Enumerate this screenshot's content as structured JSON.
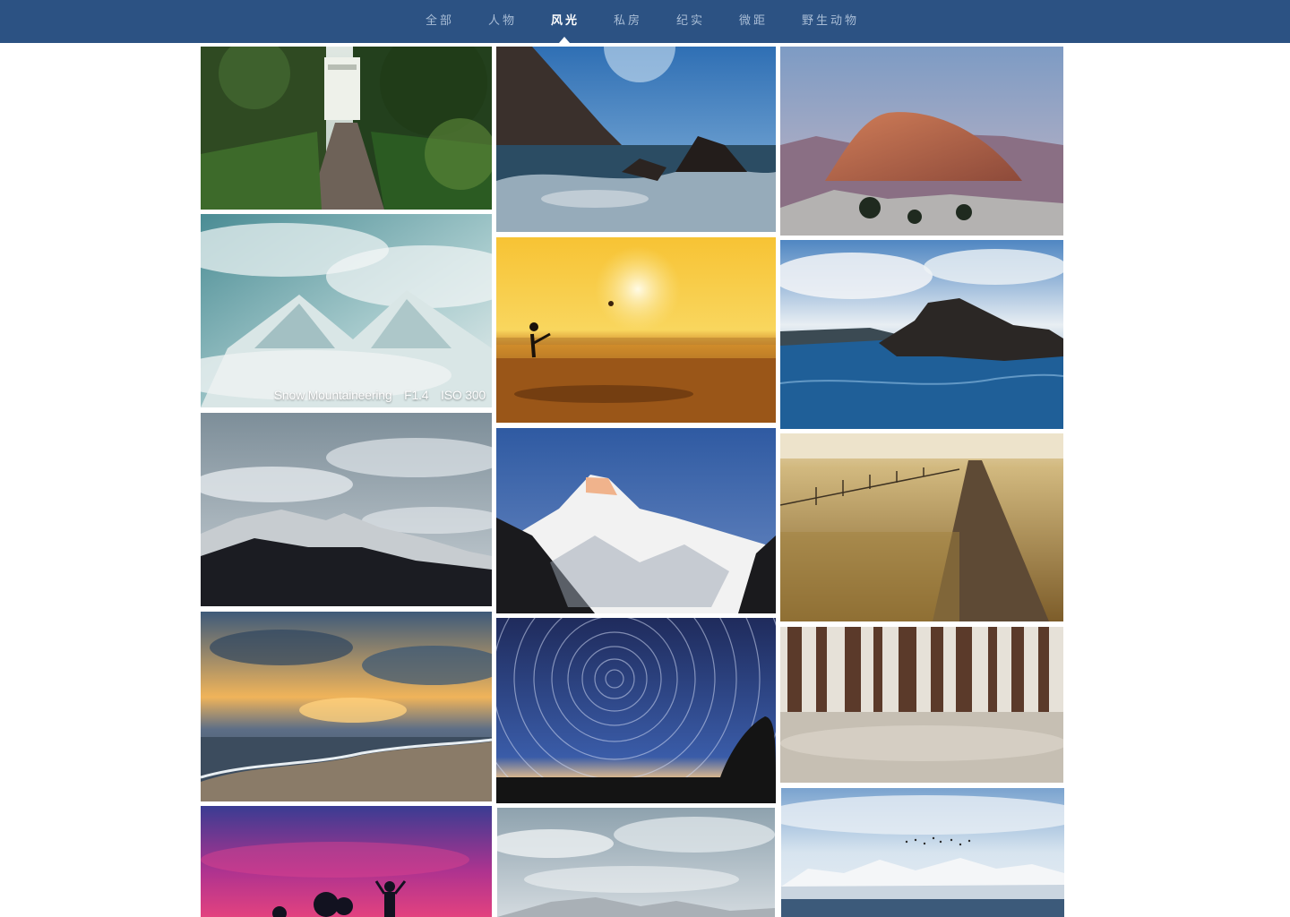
{
  "nav": {
    "items": [
      {
        "label": "全部",
        "active": false
      },
      {
        "label": "人物",
        "active": false
      },
      {
        "label": "风光",
        "active": true
      },
      {
        "label": "私房",
        "active": false
      },
      {
        "label": "纪实",
        "active": false
      },
      {
        "label": "微距",
        "active": false
      },
      {
        "label": "野生动物",
        "active": false
      }
    ],
    "background": "#2c5283"
  },
  "gallery": {
    "hover_caption": {
      "title": "Snow Mountaineering",
      "aperture": "F1.4",
      "iso": "ISO 300"
    },
    "photos": [
      {
        "subject": "forest-road-villa"
      },
      {
        "subject": "rocky-ocean-coast"
      },
      {
        "subject": "half-dome-sunset"
      },
      {
        "subject": "clouds-over-mountains"
      },
      {
        "subject": "beach-sunset-silhouette"
      },
      {
        "subject": "volcanic-rock-sea"
      },
      {
        "subject": "snowy-mountain-ridge"
      },
      {
        "subject": "snow-peak-blue-sky"
      },
      {
        "subject": "prairie-dirt-road"
      },
      {
        "subject": "sunrise-sea-waves"
      },
      {
        "subject": "star-trails"
      },
      {
        "subject": "pine-forest-frost"
      },
      {
        "subject": "purple-dusk-silhouettes"
      },
      {
        "subject": "cloudy-mountain-range"
      },
      {
        "subject": "snowfield-birds"
      }
    ]
  }
}
